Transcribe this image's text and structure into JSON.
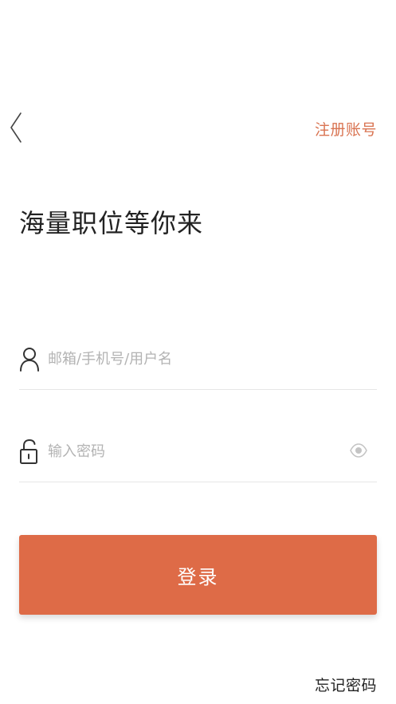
{
  "header": {
    "back_icon": "chevron-left-icon",
    "register_label": "注册账号"
  },
  "headline": "海量职位等你来",
  "form": {
    "account": {
      "icon": "user-icon",
      "placeholder": "邮箱/手机号/用户名",
      "value": ""
    },
    "password": {
      "icon": "lock-icon",
      "placeholder": "输入密码",
      "value": "",
      "toggle_icon": "eye-icon"
    },
    "login_label": "登录",
    "forgot_label": "忘记密码"
  },
  "colors": {
    "accent": "#de6b47",
    "link": "#d97452",
    "text": "#222222",
    "placeholder": "#b3b3b3",
    "divider": "#e6e6e6"
  }
}
